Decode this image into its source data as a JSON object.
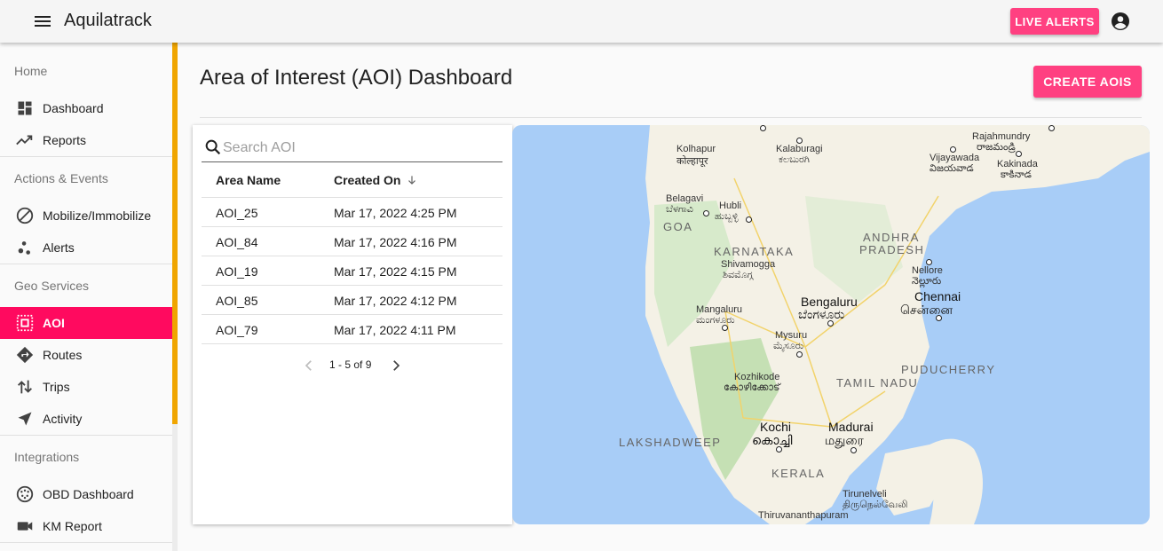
{
  "app": {
    "title": "Aquilatrack",
    "live_alerts_label": "LIVE ALERTS"
  },
  "icons": {
    "menu": "menu-icon",
    "account": "account-circle-icon",
    "search": "search-icon",
    "sort": "arrow-down-icon"
  },
  "colors": {
    "accent": "#ff4081",
    "active_nav": "#ff0a5f",
    "sidebar_accent": "#f0a500",
    "water": "#a8cdf7"
  },
  "sidebar": {
    "sections": [
      {
        "label": "Home",
        "items": [
          {
            "label": "Dashboard",
            "icon": "dashboard-icon"
          },
          {
            "label": "Reports",
            "icon": "trending-icon"
          }
        ]
      },
      {
        "label": "Actions & Events",
        "items": [
          {
            "label": "Mobilize/Immobilize",
            "icon": "block-icon"
          },
          {
            "label": "Alerts",
            "icon": "bubbles-icon"
          }
        ]
      },
      {
        "label": "Geo Services",
        "items": [
          {
            "label": "AOI",
            "icon": "select-area-icon",
            "active": true
          },
          {
            "label": "Routes",
            "icon": "directions-icon"
          },
          {
            "label": "Trips",
            "icon": "swap-vert-icon"
          },
          {
            "label": "Activity",
            "icon": "navigation-icon"
          }
        ]
      },
      {
        "label": "Integrations",
        "items": [
          {
            "label": "OBD Dashboard",
            "icon": "obd-icon"
          },
          {
            "label": "KM Report",
            "icon": "videocam-icon"
          }
        ]
      }
    ]
  },
  "main": {
    "title": "Area of Interest (AOI) Dashboard",
    "create_label": "CREATE AOIS",
    "search_placeholder": "Search AOI",
    "columns": [
      "Area Name",
      "Created On"
    ],
    "rows": [
      {
        "name": "AOI_25",
        "created": "Mar 17, 2022 4:25 PM"
      },
      {
        "name": "AOI_84",
        "created": "Mar 17, 2022 4:16 PM"
      },
      {
        "name": "AOI_19",
        "created": "Mar 17, 2022 4:15 PM"
      },
      {
        "name": "AOI_85",
        "created": "Mar 17, 2022 4:12 PM"
      },
      {
        "name": "AOI_79",
        "created": "Mar 17, 2022 4:11 PM"
      }
    ],
    "pagination": "1 - 5 of 9"
  },
  "map": {
    "labels": {
      "kolhapur": "Kolhapur",
      "kolhapur_local": "कोल्हापूर",
      "kalaburagi": "Kalaburagi",
      "kalaburagi_local": "ಕಲಬುರಗಿ",
      "rajahmundry": "Rajahmundry",
      "rajahmundry_local": "రాజమండ్రి",
      "vijayawada": "Vijayawada",
      "vijayawada_local": "విజయవాడ",
      "kakinada": "Kakinada",
      "kakinada_local": "కాకినాడ",
      "belagavi": "Belagavi",
      "belagavi_local": "ಬೆಳಗಾವಿ",
      "hubli": "Hubli",
      "hubli_local": "ಹುಬ್ಬಳ್ಳಿ",
      "goa": "GOA",
      "karnataka": "KARNATAKA",
      "andhra": "ANDHRA",
      "pradesh": "PRADESH",
      "shivamogga": "Shivamogga",
      "shivamogga_local": "ಶಿವಮೊಗ್ಗ",
      "nellore": "Nellore",
      "nellore_local": "నెల్లూరు",
      "bengaluru": "Bengaluru",
      "bengaluru_local": "ಬೆಂಗಳೂರು",
      "chennai": "Chennai",
      "chennai_local": "சென்னை",
      "mangaluru": "Mangaluru",
      "mangaluru_local": "ಮಂಗಳೂರು",
      "mysuru": "Mysuru",
      "mysuru_local": "ಮೈಸೂರು",
      "puducherry": "PUDUCHERRY",
      "kozhikode": "Kozhikode",
      "kozhikode_local": "കോഴിക്കോട്",
      "tamil_nadu": "TAMIL NADU",
      "kochi": "Kochi",
      "kochi_local": "കൊച്ചി",
      "madurai": "Madurai",
      "madurai_local": "மதுரை",
      "lakshadweep": "LAKSHADWEEP",
      "kerala": "KERALA",
      "tirunelveli": "Tirunelveli",
      "tirunelveli_local": "திருநெல்வேலி",
      "thiruvananthapuram": "Thiruvananthapuram"
    }
  }
}
